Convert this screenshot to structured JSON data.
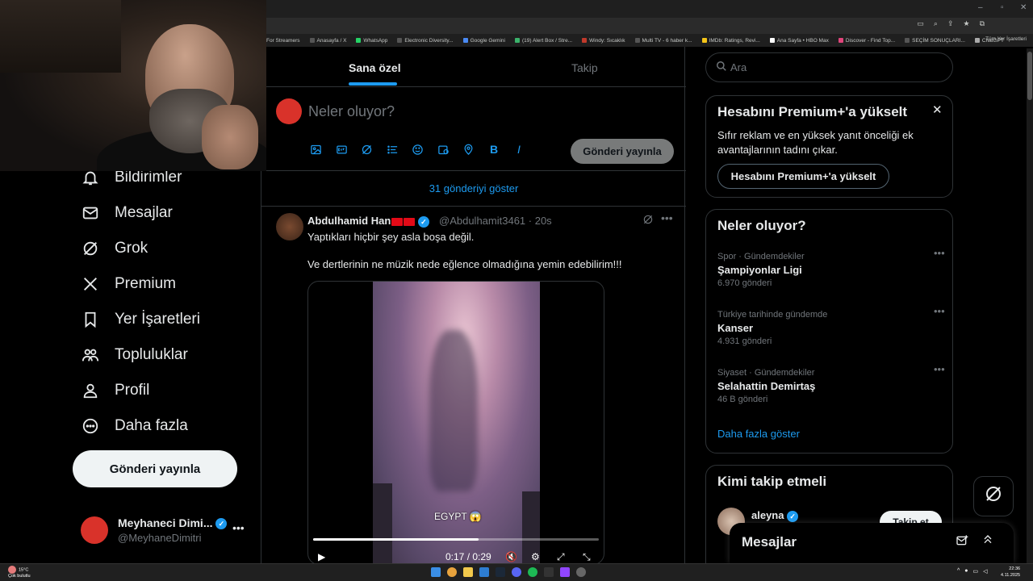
{
  "browser": {
    "window_controls": [
      "–",
      "▫",
      "✕"
    ],
    "bookmarks": [
      "For Streamers",
      "Anasayfa / X",
      "WhatsApp",
      "Electronic Diversity...",
      "Google Gemini",
      "(19) Alert Box / Stre...",
      "Windy: Sıcaklık",
      "Multi TV - 6 haber k...",
      "IMDb: Ratings, Revi...",
      "Ana Sayfa • HBO Max",
      "Discover - Find Top...",
      "SEÇİM SONUÇLARI...",
      "ChatGPT"
    ],
    "all_bookmarks": "Tüm Yer İşaretleri"
  },
  "nav": {
    "items": [
      {
        "label": "Bildirimler",
        "icon": "bell-icon"
      },
      {
        "label": "Mesajlar",
        "icon": "mail-icon"
      },
      {
        "label": "Grok",
        "icon": "grok-icon"
      },
      {
        "label": "Premium",
        "icon": "x-logo-icon"
      },
      {
        "label": "Yer İşaretleri",
        "icon": "bookmark-icon"
      },
      {
        "label": "Topluluklar",
        "icon": "communities-icon"
      },
      {
        "label": "Profil",
        "icon": "person-icon"
      },
      {
        "label": "Daha fazla",
        "icon": "more-circle-icon"
      }
    ],
    "post_button": "Gönderi yayınla",
    "account": {
      "name": "Meyhaneci Dimi...",
      "handle": "@MeyhaneDimitri",
      "more": "•••"
    }
  },
  "timeline": {
    "tabs": [
      {
        "label": "Sana özel",
        "active": true
      },
      {
        "label": "Takip",
        "active": false
      }
    ],
    "composer": {
      "placeholder": "Neler oluyor?",
      "submit": "Gönderi yayınla"
    },
    "show_more": "31 gönderiyi göster",
    "tweet": {
      "name": "Abdulhamid Han",
      "handle": "@Abdulhamit3461 · 20s",
      "text1": "Yaptıkları hiçbir şey asla boşa değil.",
      "text2": "Ve dertlerinin ne müzik nede eğlence olmadığına yemin edebilirim!!!",
      "video_caption": "EGYPT 😱",
      "video_time": "0:17 / 0:29",
      "progress": 0.58
    }
  },
  "right": {
    "search_placeholder": "Ara",
    "premium": {
      "title": "Hesabını Premium+'a yükselt",
      "desc": "Sıfır reklam ve en yüksek yanıt önceliği ek avantajlarının tadını çıkar.",
      "button": "Hesabını Premium+'a yükselt"
    },
    "trends": {
      "title": "Neler oluyor?",
      "items": [
        {
          "context": "Spor · Gündemdekiler",
          "topic": "Şampiyonlar Ligi",
          "count": "6.970 gönderi"
        },
        {
          "context": "Türkiye tarihinde gündemde",
          "topic": "Kanser",
          "count": "4.931 gönderi"
        },
        {
          "context": "Siyaset · Gündemdekiler",
          "topic": "Selahattin Demirtaş",
          "count": "46 B gönderi"
        }
      ],
      "show_all": "Daha fazla göster"
    },
    "who_to_follow": {
      "title": "Kimi takip etmeli",
      "name": "aleyna",
      "button": "Takip et"
    },
    "messages_dock": "Mesajlar"
  },
  "taskbar": {
    "weather_temp": "15°C",
    "weather_desc": "Çok bulutlu",
    "time": "22:36",
    "date": "4.11.2025"
  }
}
